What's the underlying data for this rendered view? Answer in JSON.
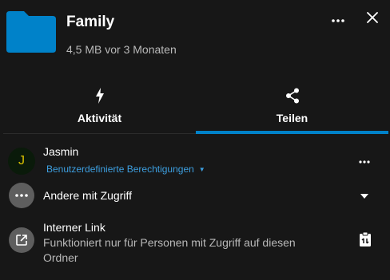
{
  "header": {
    "title": "Family",
    "subtitle": "4,5 MB vor 3 Monaten",
    "folder_color": "#0082c9"
  },
  "tabs": [
    {
      "label": "Aktivität",
      "icon": "flash-icon",
      "active": false
    },
    {
      "label": "Teilen",
      "icon": "share-icon",
      "active": true
    }
  ],
  "shares": {
    "user": {
      "avatar_letter": "J",
      "name": "Jasmin",
      "permissions": "Benutzerdefinierte Berechtigungen",
      "permission_color": "#3d9fe0"
    },
    "others": {
      "label": "Andere mit Zugriff"
    },
    "internal_link": {
      "title": "Interner Link",
      "description": "Funktioniert nur für Personen mit Zugriff auf diesen Ordner"
    }
  },
  "colors": {
    "background": "#171717",
    "accent": "#0082c9",
    "muted_text": "#b9b9b9"
  }
}
